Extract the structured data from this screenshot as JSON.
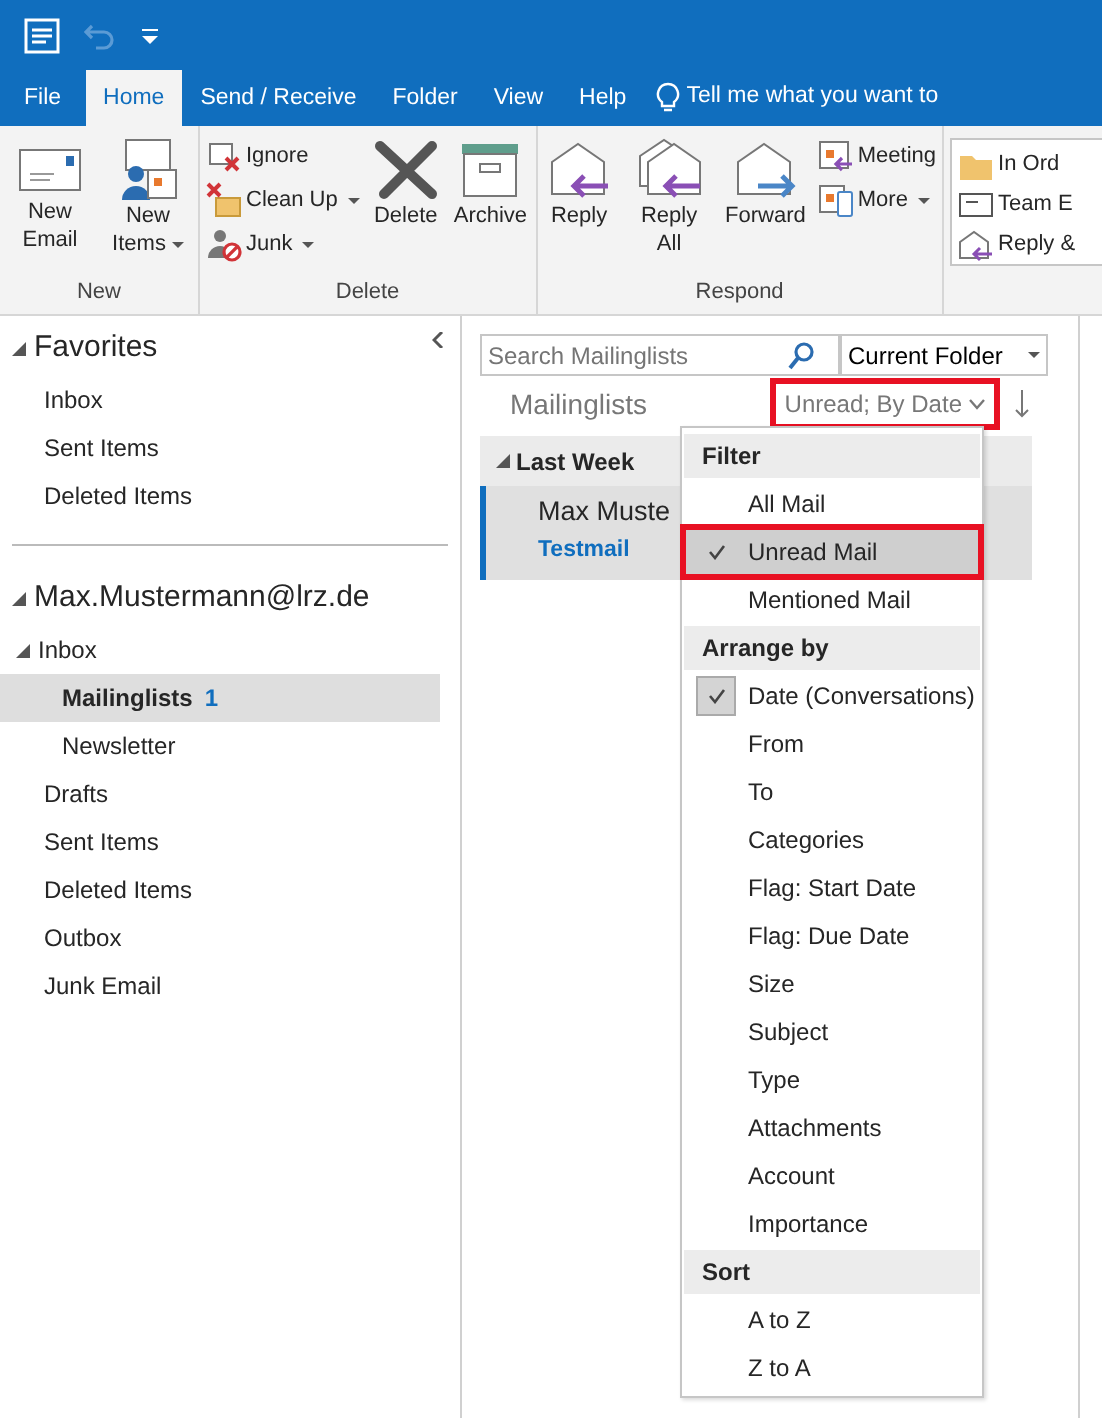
{
  "tabs": [
    {
      "label": "File",
      "selected": false
    },
    {
      "label": "Home",
      "selected": true
    },
    {
      "label": "Send / Receive",
      "selected": false
    },
    {
      "label": "Folder",
      "selected": false
    },
    {
      "label": "View",
      "selected": false
    },
    {
      "label": "Help",
      "selected": false
    }
  ],
  "tell_me": "Tell me what you want to",
  "ribbon": [
    {
      "label": "New",
      "buttons": [
        {
          "kind": "large",
          "label": "New Email",
          "dropdown": false
        },
        {
          "kind": "large",
          "label": "New Items",
          "dropdown": true
        }
      ]
    },
    {
      "label": "Delete",
      "buttons": [
        {
          "kind": "small",
          "label": "Ignore",
          "dropdown": false
        },
        {
          "kind": "small",
          "label": "Clean Up",
          "dropdown": true
        },
        {
          "kind": "small",
          "label": "Junk",
          "dropdown": true
        },
        {
          "kind": "large",
          "label": "Delete",
          "dropdown": false
        },
        {
          "kind": "large",
          "label": "Archive",
          "dropdown": false
        }
      ]
    },
    {
      "label": "Respond",
      "buttons": [
        {
          "kind": "large",
          "label": "Reply",
          "dropdown": false
        },
        {
          "kind": "large",
          "label": "Reply All",
          "dropdown": false
        },
        {
          "kind": "large",
          "label": "Forward",
          "dropdown": false
        },
        {
          "kind": "small",
          "label": "Meeting",
          "dropdown": false
        },
        {
          "kind": "small",
          "label": "More",
          "dropdown": true
        }
      ]
    }
  ],
  "quick_steps": [
    "In Ord",
    "Team E",
    "Reply &"
  ],
  "sidebar": {
    "favorites": {
      "label": "Favorites",
      "expanded": true,
      "items": [
        {
          "label": "Inbox",
          "selected": false
        },
        {
          "label": "Sent Items",
          "selected": false
        },
        {
          "label": "Deleted Items",
          "selected": false
        }
      ]
    },
    "account": {
      "label": "Max.Mustermann@lrz.de",
      "expanded": true,
      "folders": [
        {
          "label": "Inbox",
          "selected": false,
          "expanded": true,
          "children": [
            {
              "label": "Mailinglists",
              "selected": true,
              "count": "1"
            },
            {
              "label": "Newsletter",
              "selected": false
            }
          ]
        },
        {
          "label": "Drafts",
          "selected": false
        },
        {
          "label": "Sent Items",
          "selected": false
        },
        {
          "label": "Deleted Items",
          "selected": false
        },
        {
          "label": "Outbox",
          "selected": false
        },
        {
          "label": "Junk Email",
          "selected": false
        }
      ]
    }
  },
  "search": {
    "placeholder": "Search Mailinglists",
    "scope": "Current Folder"
  },
  "folder_title": "Mailinglists",
  "sort_label": {
    "text": "Unread; By Date",
    "highlighted": true
  },
  "mail_list": {
    "group": "Last Week",
    "expanded": true,
    "messages": [
      {
        "sender": "Max Muste",
        "subject": "Testmail",
        "unread": true
      }
    ]
  },
  "menu": [
    {
      "header": "Filter",
      "items": [
        {
          "label": "All Mail",
          "checked": false,
          "selected": false,
          "highlighted": false
        },
        {
          "label": "Unread Mail",
          "checked": true,
          "selected": true,
          "highlighted": true
        },
        {
          "label": "Mentioned Mail",
          "checked": false,
          "selected": false,
          "highlighted": false
        }
      ]
    },
    {
      "header": "Arrange by",
      "items": [
        {
          "label": "Date (Conversations)",
          "checked": true,
          "selected": false,
          "highlighted": false
        },
        {
          "label": "From",
          "checked": false,
          "selected": false,
          "highlighted": false
        },
        {
          "label": "To",
          "checked": false,
          "selected": false,
          "highlighted": false
        },
        {
          "label": "Categories",
          "checked": false,
          "selected": false,
          "highlighted": false
        },
        {
          "label": "Flag: Start Date",
          "checked": false,
          "selected": false,
          "highlighted": false
        },
        {
          "label": "Flag: Due Date",
          "checked": false,
          "selected": false,
          "highlighted": false
        },
        {
          "label": "Size",
          "checked": false,
          "selected": false,
          "highlighted": false
        },
        {
          "label": "Subject",
          "checked": false,
          "selected": false,
          "highlighted": false
        },
        {
          "label": "Type",
          "checked": false,
          "selected": false,
          "highlighted": false
        },
        {
          "label": "Attachments",
          "checked": false,
          "selected": false,
          "highlighted": false
        },
        {
          "label": "Account",
          "checked": false,
          "selected": false,
          "highlighted": false
        },
        {
          "label": "Importance",
          "checked": false,
          "selected": false,
          "highlighted": false
        }
      ]
    },
    {
      "header": "Sort",
      "items": [
        {
          "label": "A to Z",
          "checked": false,
          "selected": false,
          "highlighted": false
        },
        {
          "label": "Z to A",
          "checked": false,
          "selected": false,
          "highlighted": false
        }
      ]
    }
  ]
}
